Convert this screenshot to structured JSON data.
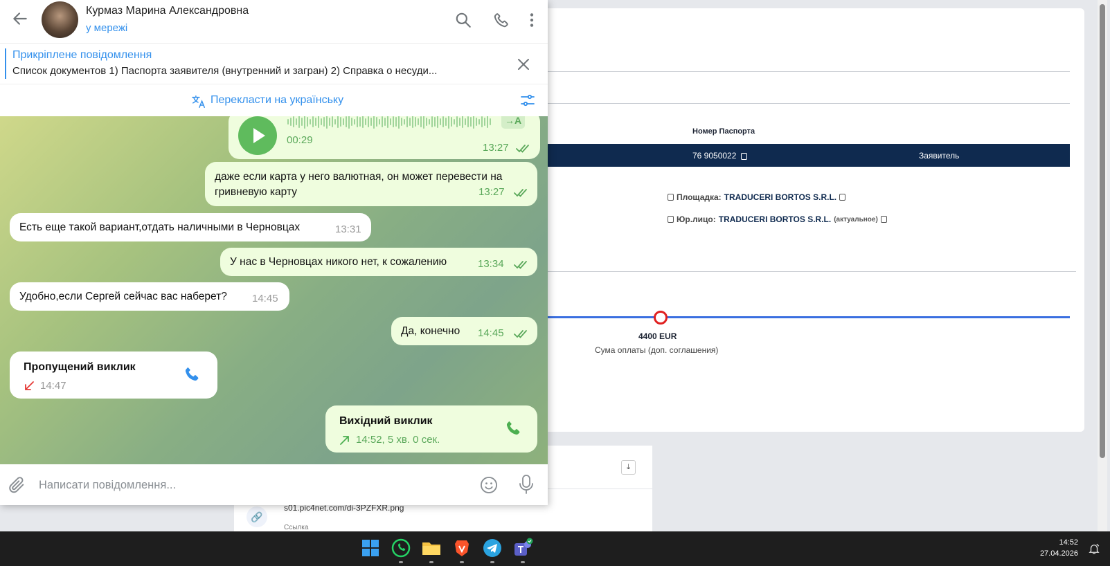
{
  "background_page": {
    "passport_label": "Номер Паспорта",
    "passport_number": "76 9050022",
    "role": "Заявитель",
    "platform_label": "Площадка:",
    "platform_value": "TRADUCERI BORTOS S.R.L.",
    "legal_label": "Юр.лицо:",
    "legal_value": "TRADUCERI BORTOS S.R.L.",
    "legal_note": "(актуальное)",
    "timeline_amount": "4400 EUR",
    "timeline_caption": "Сума оплаты (доп. соглашения)",
    "attachment_url": "s01.pic4net.com/di-3PZFXR.png",
    "attachment_caption": "Ссылка",
    "colors": {
      "navy": "#0f2a4f",
      "timeline": "#3a6fe0",
      "timeline_point": "#e02020"
    }
  },
  "telegram": {
    "header": {
      "contact_name": "Курмаз Марина Александровна",
      "status": "у мережі",
      "icons": [
        "back-arrow-icon",
        "search-icon",
        "phone-icon",
        "more-vertical-icon"
      ]
    },
    "pinned": {
      "title": "Прикріплене повідомлення",
      "text": "Список документов    1) Паспорта заявителя (внутренний и загран) 2) Справка о несуди..."
    },
    "translate": {
      "label": "Перекласти на українську"
    },
    "messages": {
      "voice": {
        "duration": "00:29",
        "time": "13:27",
        "transcribe_label": "→A"
      },
      "m1": {
        "text1": "даже если карта у него валютная, он может перевести на",
        "text2": "гривневую карту",
        "time": "13:27"
      },
      "m2": {
        "text": "Есть еще такой вариант,отдать наличными в Черновцах",
        "time": "13:31"
      },
      "m3": {
        "text": "У нас в Черновцах никого нет, к сожалению",
        "time": "13:34"
      },
      "m4": {
        "text": "Удобно,если Сергей сейчас вас наберет?",
        "time": "14:45"
      },
      "m5": {
        "text": "Да, конечно",
        "time": "14:45"
      },
      "missed_call": {
        "title": "Пропущений виклик",
        "time": "14:47"
      },
      "outgoing_call": {
        "title": "Вихідний виклик",
        "details": "14:52, 5 хв. 0 сек."
      }
    },
    "input": {
      "placeholder": "Написати повідомлення..."
    },
    "colors": {
      "accent": "#3390ec",
      "outgoing_bubble": "#effdde",
      "green": "#5fbb5d",
      "missed": "#e53935"
    }
  },
  "taskbar": {
    "apps": [
      "windows-start-icon",
      "whatsapp-icon",
      "file-explorer-icon",
      "brave-icon",
      "telegram-icon",
      "teams-icon"
    ],
    "time": "14:52",
    "date": "27.04.2026"
  }
}
